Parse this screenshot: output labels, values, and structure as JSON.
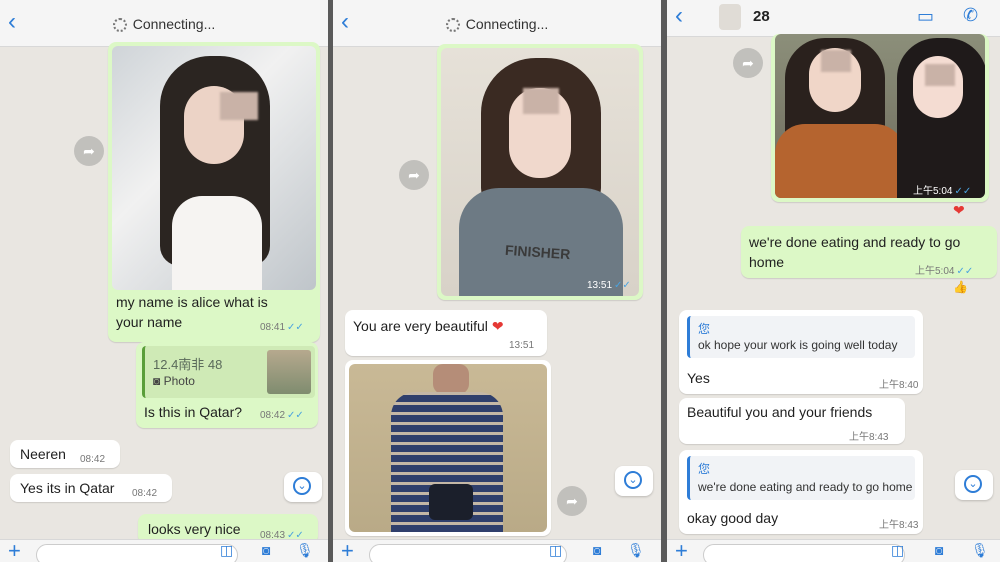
{
  "colors": {
    "accent": "#2e7dd7",
    "outgoing": "#dcf8c6",
    "incoming": "#ffffff",
    "chat_bg": "#e9e6e1",
    "heart": "#e53935"
  },
  "icons": [
    "back-chevron-icon",
    "spinner-icon",
    "forward-icon",
    "scroll-down-icon",
    "plus-icon",
    "sticker-icon",
    "camera-icon",
    "mic-icon",
    "video-call-icon",
    "phone-icon",
    "heart-icon",
    "double-check-icon"
  ],
  "phone1": {
    "header": {
      "status": "Connecting..."
    },
    "messages": {
      "m1_text": "my name is alice what is your name",
      "m1_time": "08:41",
      "reply_header": "12.4南非 48",
      "reply_label": "Photo",
      "m2_text": "Is this in Qatar?",
      "m2_time": "08:42",
      "m3_text": "Neeren",
      "m3_time": "08:42",
      "m4_text": "Yes its in Qatar",
      "m4_time": "08:42",
      "m5_text": "looks very nice",
      "m5_time": "08:43"
    }
  },
  "phone2": {
    "header": {
      "status": "Connecting..."
    },
    "messages": {
      "photo_time": "13:51",
      "shirt_text": "FINISHER",
      "m1_text": "You are very beautiful",
      "m1_time": "13:51"
    }
  },
  "phone3": {
    "header": {
      "contact": "28"
    },
    "messages": {
      "photo_time": "上午5:04",
      "m1_text": "we're done eating and ready to go home",
      "m1_time": "上午5:04",
      "q1_name": "您",
      "q1_text": "ok hope your work is going well today",
      "r1_text": "Yes",
      "r1_time": "上午8:40",
      "m2_text": "Beautiful you and your friends",
      "m2_time": "上午8:43",
      "q2_name": "您",
      "q2_text": "we're done eating and ready to go home",
      "r2_text": "okay good day",
      "r2_time": "上午8:43"
    }
  }
}
